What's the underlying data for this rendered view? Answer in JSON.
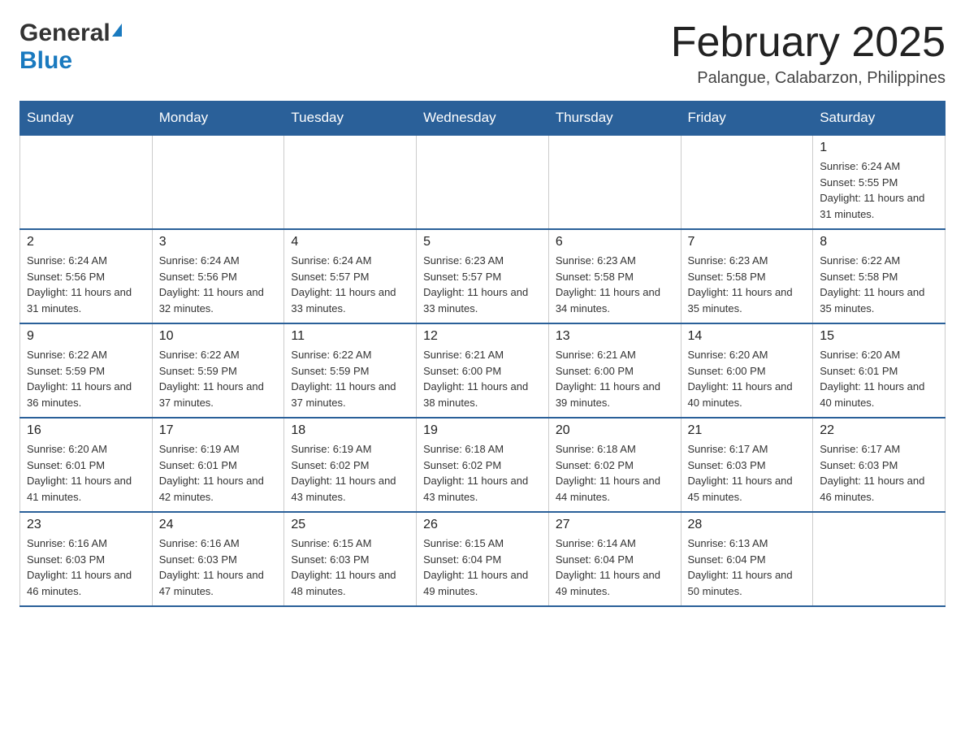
{
  "logo": {
    "general": "General",
    "blue": "Blue"
  },
  "header": {
    "title": "February 2025",
    "location": "Palangue, Calabarzon, Philippines"
  },
  "days_of_week": [
    "Sunday",
    "Monday",
    "Tuesday",
    "Wednesday",
    "Thursday",
    "Friday",
    "Saturday"
  ],
  "weeks": [
    [
      {
        "day": "",
        "info": ""
      },
      {
        "day": "",
        "info": ""
      },
      {
        "day": "",
        "info": ""
      },
      {
        "day": "",
        "info": ""
      },
      {
        "day": "",
        "info": ""
      },
      {
        "day": "",
        "info": ""
      },
      {
        "day": "1",
        "info": "Sunrise: 6:24 AM\nSunset: 5:55 PM\nDaylight: 11 hours and 31 minutes."
      }
    ],
    [
      {
        "day": "2",
        "info": "Sunrise: 6:24 AM\nSunset: 5:56 PM\nDaylight: 11 hours and 31 minutes."
      },
      {
        "day": "3",
        "info": "Sunrise: 6:24 AM\nSunset: 5:56 PM\nDaylight: 11 hours and 32 minutes."
      },
      {
        "day": "4",
        "info": "Sunrise: 6:24 AM\nSunset: 5:57 PM\nDaylight: 11 hours and 33 minutes."
      },
      {
        "day": "5",
        "info": "Sunrise: 6:23 AM\nSunset: 5:57 PM\nDaylight: 11 hours and 33 minutes."
      },
      {
        "day": "6",
        "info": "Sunrise: 6:23 AM\nSunset: 5:58 PM\nDaylight: 11 hours and 34 minutes."
      },
      {
        "day": "7",
        "info": "Sunrise: 6:23 AM\nSunset: 5:58 PM\nDaylight: 11 hours and 35 minutes."
      },
      {
        "day": "8",
        "info": "Sunrise: 6:22 AM\nSunset: 5:58 PM\nDaylight: 11 hours and 35 minutes."
      }
    ],
    [
      {
        "day": "9",
        "info": "Sunrise: 6:22 AM\nSunset: 5:59 PM\nDaylight: 11 hours and 36 minutes."
      },
      {
        "day": "10",
        "info": "Sunrise: 6:22 AM\nSunset: 5:59 PM\nDaylight: 11 hours and 37 minutes."
      },
      {
        "day": "11",
        "info": "Sunrise: 6:22 AM\nSunset: 5:59 PM\nDaylight: 11 hours and 37 minutes."
      },
      {
        "day": "12",
        "info": "Sunrise: 6:21 AM\nSunset: 6:00 PM\nDaylight: 11 hours and 38 minutes."
      },
      {
        "day": "13",
        "info": "Sunrise: 6:21 AM\nSunset: 6:00 PM\nDaylight: 11 hours and 39 minutes."
      },
      {
        "day": "14",
        "info": "Sunrise: 6:20 AM\nSunset: 6:00 PM\nDaylight: 11 hours and 40 minutes."
      },
      {
        "day": "15",
        "info": "Sunrise: 6:20 AM\nSunset: 6:01 PM\nDaylight: 11 hours and 40 minutes."
      }
    ],
    [
      {
        "day": "16",
        "info": "Sunrise: 6:20 AM\nSunset: 6:01 PM\nDaylight: 11 hours and 41 minutes."
      },
      {
        "day": "17",
        "info": "Sunrise: 6:19 AM\nSunset: 6:01 PM\nDaylight: 11 hours and 42 minutes."
      },
      {
        "day": "18",
        "info": "Sunrise: 6:19 AM\nSunset: 6:02 PM\nDaylight: 11 hours and 43 minutes."
      },
      {
        "day": "19",
        "info": "Sunrise: 6:18 AM\nSunset: 6:02 PM\nDaylight: 11 hours and 43 minutes."
      },
      {
        "day": "20",
        "info": "Sunrise: 6:18 AM\nSunset: 6:02 PM\nDaylight: 11 hours and 44 minutes."
      },
      {
        "day": "21",
        "info": "Sunrise: 6:17 AM\nSunset: 6:03 PM\nDaylight: 11 hours and 45 minutes."
      },
      {
        "day": "22",
        "info": "Sunrise: 6:17 AM\nSunset: 6:03 PM\nDaylight: 11 hours and 46 minutes."
      }
    ],
    [
      {
        "day": "23",
        "info": "Sunrise: 6:16 AM\nSunset: 6:03 PM\nDaylight: 11 hours and 46 minutes."
      },
      {
        "day": "24",
        "info": "Sunrise: 6:16 AM\nSunset: 6:03 PM\nDaylight: 11 hours and 47 minutes."
      },
      {
        "day": "25",
        "info": "Sunrise: 6:15 AM\nSunset: 6:03 PM\nDaylight: 11 hours and 48 minutes."
      },
      {
        "day": "26",
        "info": "Sunrise: 6:15 AM\nSunset: 6:04 PM\nDaylight: 11 hours and 49 minutes."
      },
      {
        "day": "27",
        "info": "Sunrise: 6:14 AM\nSunset: 6:04 PM\nDaylight: 11 hours and 49 minutes."
      },
      {
        "day": "28",
        "info": "Sunrise: 6:13 AM\nSunset: 6:04 PM\nDaylight: 11 hours and 50 minutes."
      },
      {
        "day": "",
        "info": ""
      }
    ]
  ]
}
